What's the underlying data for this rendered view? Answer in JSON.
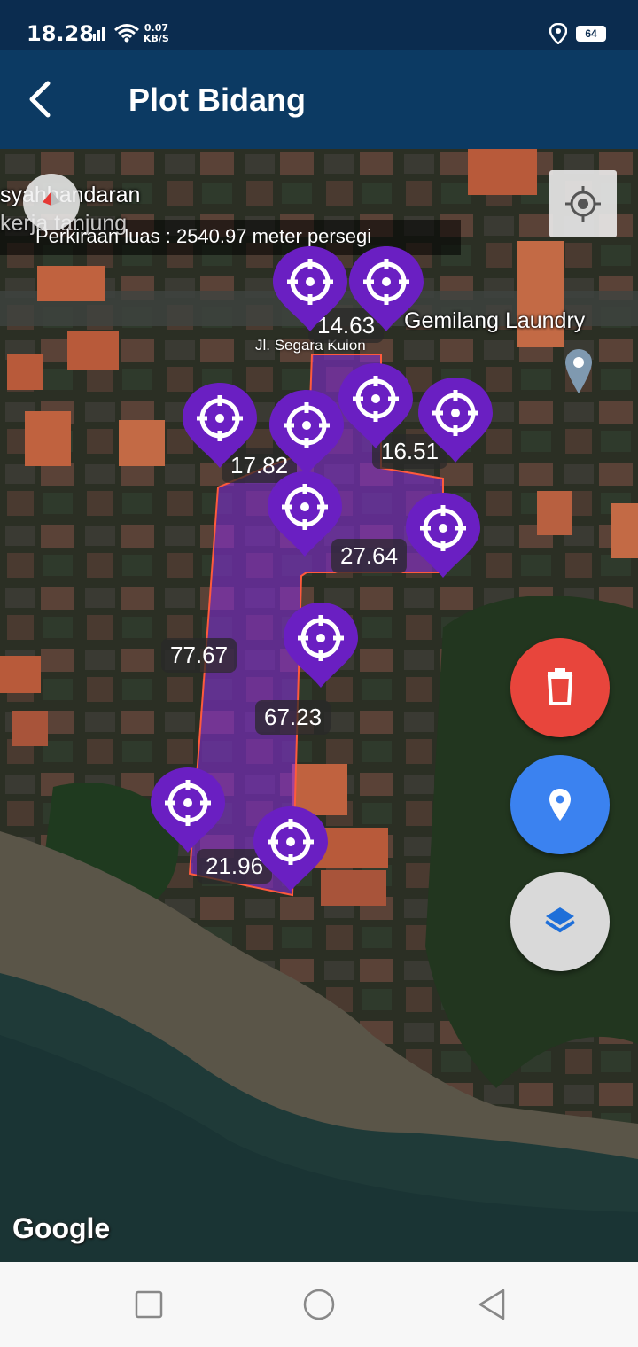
{
  "status_bar": {
    "time": "18.28",
    "net_speed_value": "0.07",
    "net_speed_unit": "KB/S",
    "battery": "64",
    "icons": [
      "signal-icon",
      "wifi-icon",
      "location-icon",
      "battery-icon"
    ]
  },
  "app_bar": {
    "title": "Plot Bidang",
    "back_icon": "arrow-back-icon"
  },
  "map": {
    "area_estimate": "Perkiraan luas : 2540.97 meter persegi",
    "poi_labels": {
      "syahbandaran": "syahbandaran",
      "kerja_tanjung": "kerja tanjung",
      "laundry": "Gemilang Laundry",
      "street": "Jl. Segara Kulon"
    },
    "measurements": [
      "14.63",
      "17.82",
      "16.51",
      "27.64",
      "77.67",
      "67.23",
      "21.96"
    ],
    "attribution": "Google",
    "polygon_fill": "#8b2be2",
    "polygon_stroke": "#ff5a3c",
    "marker_color": "#6a1fc2"
  },
  "fabs": {
    "delete_color": "#e8453c",
    "location_color": "#3b82f0",
    "layers_color": "#d9d9d9"
  }
}
